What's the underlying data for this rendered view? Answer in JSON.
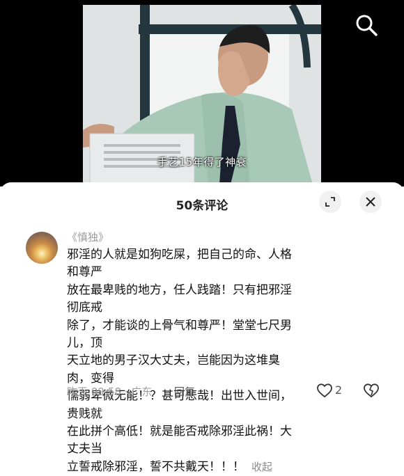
{
  "video": {
    "subtitle": "手艺15年得了神衰"
  },
  "comments_panel": {
    "title": "50条评论",
    "icons": {
      "expand": "expand-icon",
      "close": "close-icon"
    }
  },
  "comment": {
    "username": "《慎独》",
    "text": "邪淫的人就是如狗吃屎，把自己的命、人格和尊严\n放在最卑贱的地方，任人践踏！只有把邪淫彻底戒\n除了，才能谈的上骨气和尊严！堂堂七尺男儿，顶\n天立地的男子汉大丈夫，岂能因为这堆臭肉，变得\n懦弱卑微无能！？甚可悲哉！出世入世间，贵贱就\n在此拼个高低！就是能否戒除邪淫此祸！大丈夫当\n立誓戒除邪淫，誓不共戴天！！！",
    "collapse_label": "收起",
    "time_location": "昨天 09:58 · 广东",
    "reply_label": "回复",
    "like_count": "2"
  },
  "colors": {
    "accent_text": "#111111",
    "muted": "#9a9a9a",
    "video_bg": "#000000"
  }
}
